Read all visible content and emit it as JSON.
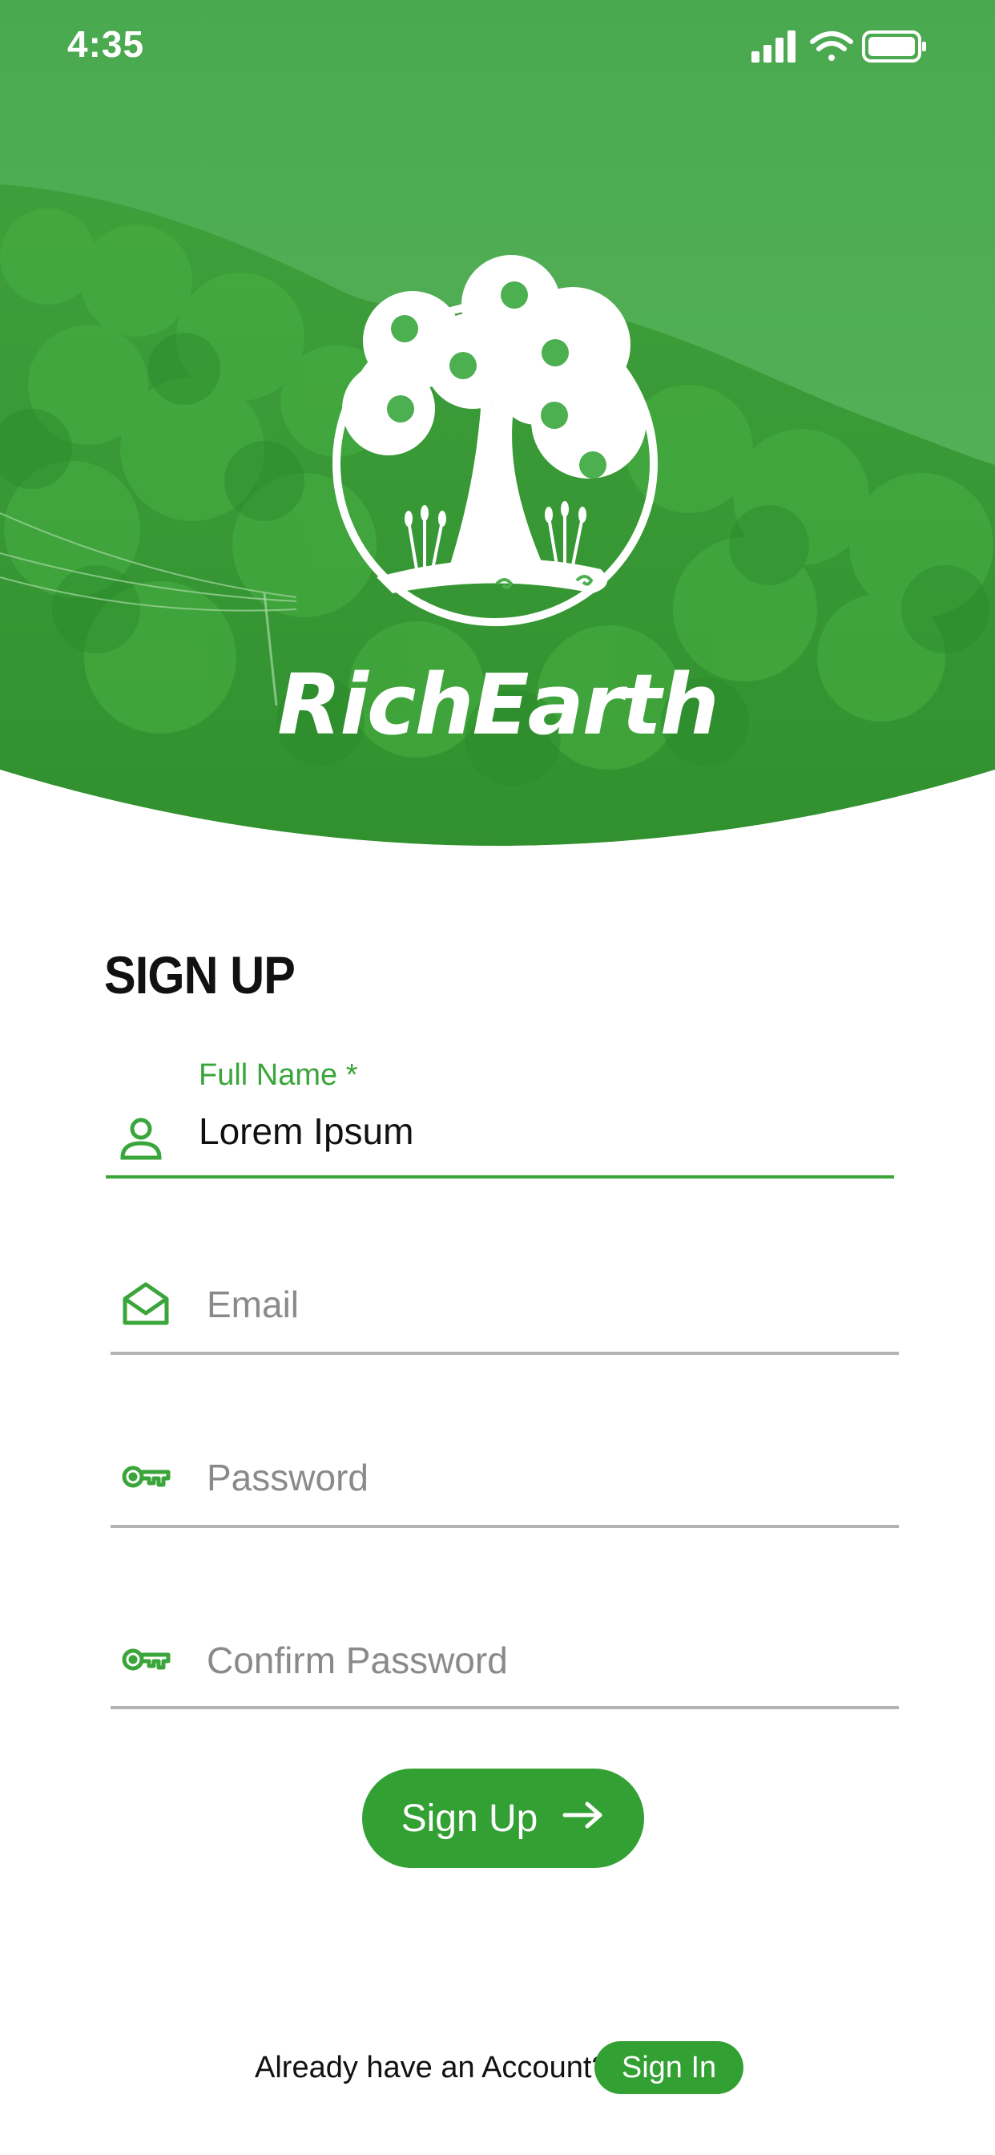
{
  "status_bar": {
    "time": "4:35"
  },
  "brand": {
    "name": "RichEarth"
  },
  "page": {
    "title": "SIGN UP"
  },
  "form": {
    "full_name": {
      "label": "Full Name *",
      "value": "Lorem Ipsum",
      "icon": "person-icon"
    },
    "email": {
      "placeholder": "Email",
      "icon": "envelope-icon"
    },
    "password": {
      "placeholder": "Password",
      "icon": "key-icon"
    },
    "confirm_password": {
      "placeholder": "Confirm Password",
      "icon": "key-icon"
    }
  },
  "actions": {
    "signup_label": "Sign Up"
  },
  "footer": {
    "prompt": "Already have an Account?",
    "signin_label": "Sign In"
  },
  "colors": {
    "brand_green": "#33a033",
    "hero_green": "#4caf50",
    "placeholder_gray": "#8a8a8a"
  }
}
